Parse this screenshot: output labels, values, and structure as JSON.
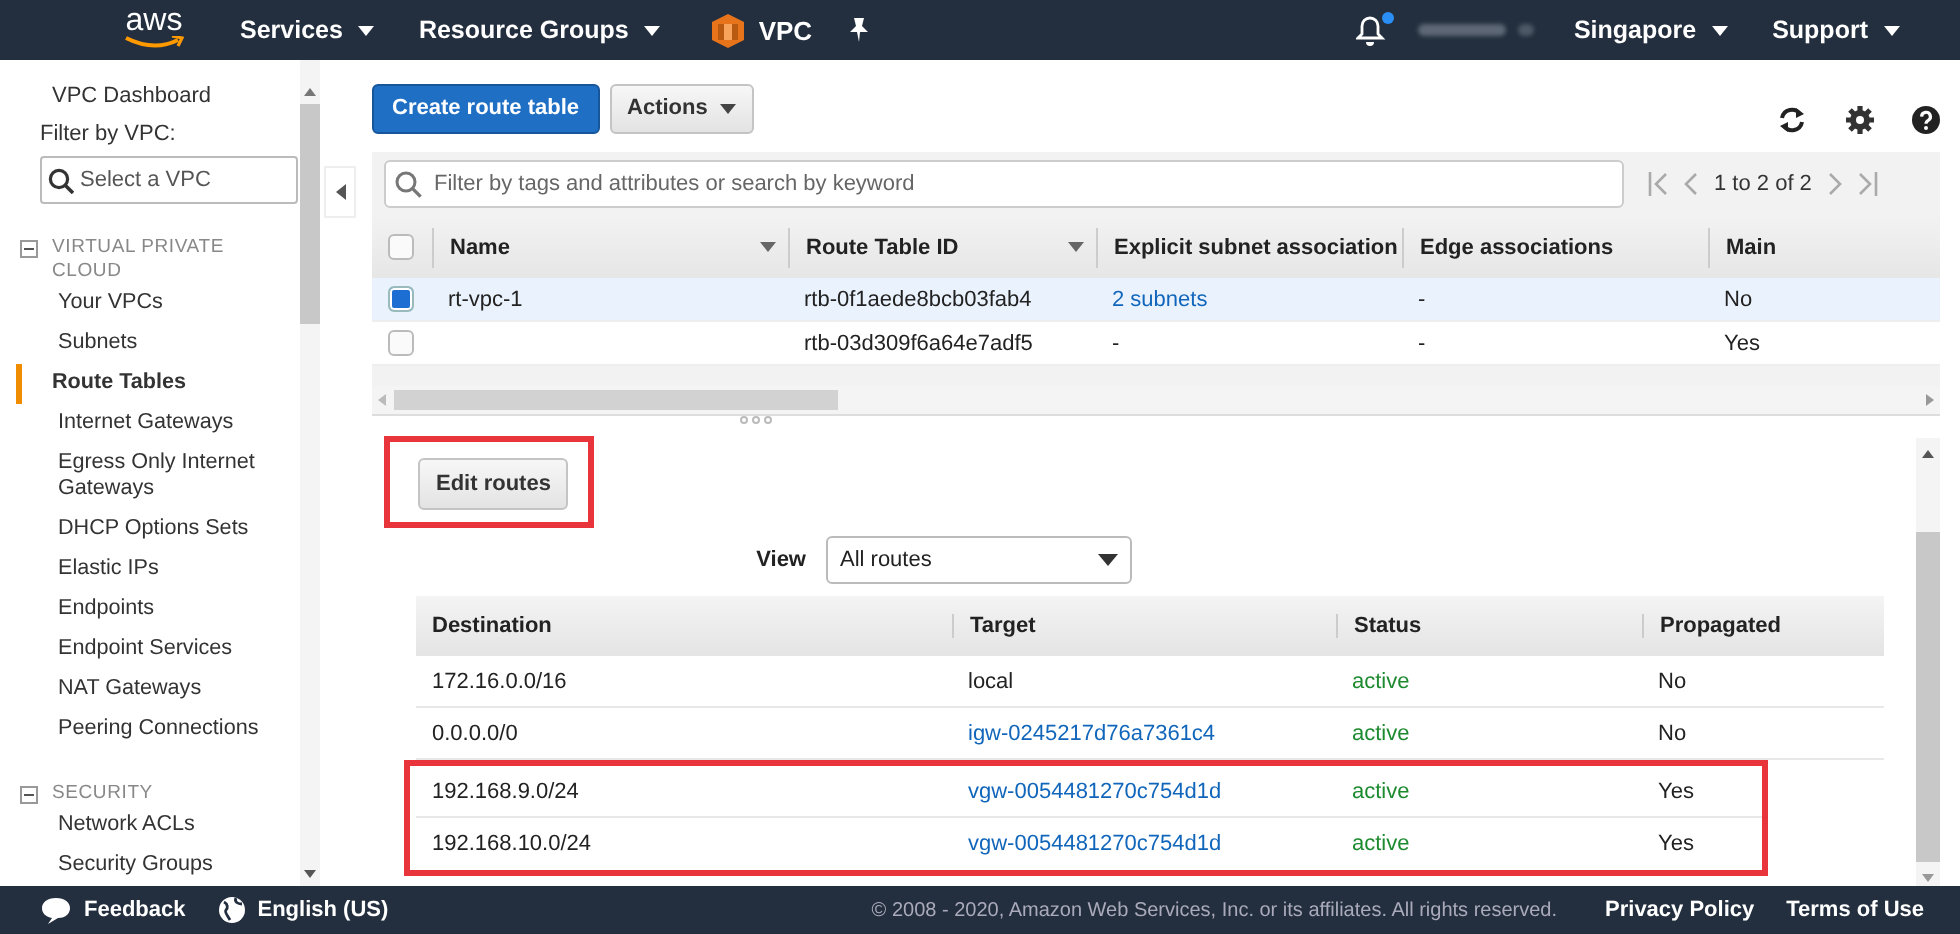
{
  "header": {
    "logo": "aws",
    "menus": [
      {
        "label": "Services"
      },
      {
        "label": "Resource Groups"
      }
    ],
    "service": "VPC",
    "region": "Singapore",
    "support": "Support",
    "notification_dot": true
  },
  "sidebar": {
    "top_link": "VPC Dashboard",
    "filter_label": "Filter by VPC:",
    "filter_placeholder": "Select a VPC",
    "sections": [
      {
        "title": "VIRTUAL PRIVATE CLOUD",
        "expanded": true,
        "items": [
          {
            "label": "Your VPCs",
            "selected": false
          },
          {
            "label": "Subnets",
            "selected": false
          },
          {
            "label": "Route Tables",
            "selected": true
          },
          {
            "label": "Internet Gateways",
            "selected": false
          },
          {
            "label": "Egress Only Internet Gateways",
            "selected": false
          },
          {
            "label": "DHCP Options Sets",
            "selected": false
          },
          {
            "label": "Elastic IPs",
            "selected": false
          },
          {
            "label": "Endpoints",
            "selected": false
          },
          {
            "label": "Endpoint Services",
            "selected": false
          },
          {
            "label": "NAT Gateways",
            "selected": false
          },
          {
            "label": "Peering Connections",
            "selected": false
          }
        ]
      },
      {
        "title": "SECURITY",
        "expanded": true,
        "items": [
          {
            "label": "Network ACLs",
            "selected": false
          },
          {
            "label": "Security Groups",
            "selected": false
          }
        ]
      }
    ]
  },
  "toolbar": {
    "create_button": "Create route table",
    "actions_button": "Actions"
  },
  "filter": {
    "placeholder": "Filter by tags and attributes or search by keyword",
    "pagination": "1 to 2 of 2"
  },
  "route_tables": {
    "select_all_checked": false,
    "columns": [
      "Name",
      "Route Table ID",
      "Explicit subnet association",
      "Edge associations",
      "Main"
    ],
    "rows": [
      {
        "selected": true,
        "cells": [
          "rt-vpc-1",
          "rtb-0f1aede8bcb03fab4",
          "2 subnets",
          "-",
          "No"
        ]
      },
      {
        "selected": false,
        "cells": [
          "",
          "rtb-03d309f6a64e7adf5",
          "-",
          "-",
          "Yes"
        ]
      }
    ]
  },
  "details": {
    "edit_button": {
      "label": "Edit routes",
      "highlighted": true
    },
    "view_label": "View",
    "view_value": "All routes",
    "columns": [
      "Destination",
      "Target",
      "Status",
      "Propagated"
    ],
    "routes": [
      {
        "destination": "172.16.0.0/16",
        "target": "local",
        "target_link": false,
        "status": "active",
        "propagated": "No",
        "highlighted": false
      },
      {
        "destination": "0.0.0.0/0",
        "target": "igw-0245217d76a7361c4",
        "target_link": true,
        "status": "active",
        "propagated": "No",
        "highlighted": false
      },
      {
        "destination": "192.168.9.0/24",
        "target": "vgw-0054481270c754d1d",
        "target_link": true,
        "status": "active",
        "propagated": "Yes",
        "highlighted": true
      },
      {
        "destination": "192.168.10.0/24",
        "target": "vgw-0054481270c754d1d",
        "target_link": true,
        "status": "active",
        "propagated": "Yes",
        "highlighted": true
      }
    ]
  },
  "footer": {
    "feedback": "Feedback",
    "language": "English (US)",
    "copyright": "© 2008 - 2020, Amazon Web Services, Inc. or its affiliates. All rights reserved.",
    "links": [
      "Privacy Policy",
      "Terms of Use"
    ]
  }
}
